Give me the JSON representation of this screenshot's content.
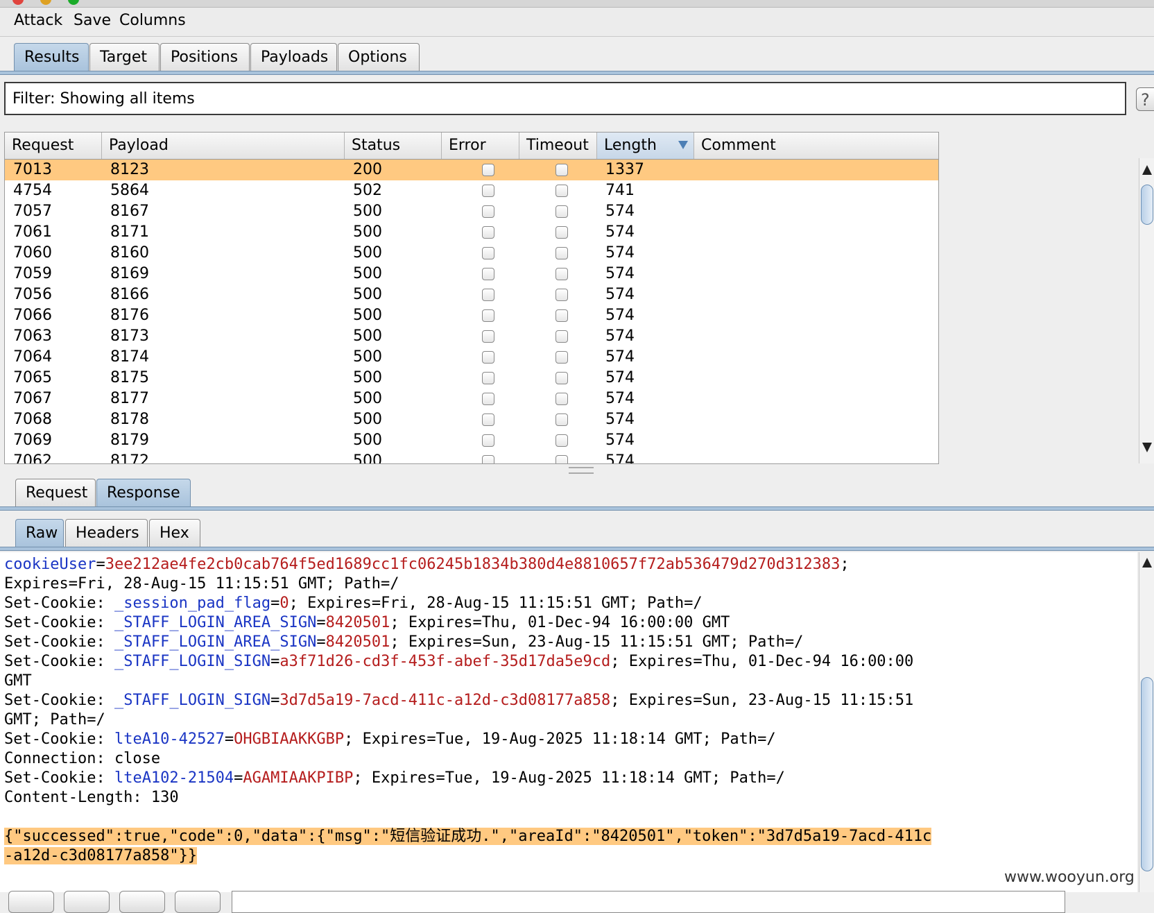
{
  "menu": [
    "Attack",
    "Save",
    "Columns"
  ],
  "main_tabs": [
    {
      "label": "Results",
      "active": true
    },
    {
      "label": "Target",
      "active": false
    },
    {
      "label": "Positions",
      "active": false
    },
    {
      "label": "Payloads",
      "active": false
    },
    {
      "label": "Options",
      "active": false
    }
  ],
  "filter": {
    "text": "Filter:  Showing all items",
    "help": "?"
  },
  "table": {
    "columns": [
      "Request",
      "Payload",
      "Status",
      "Error",
      "Timeout",
      "Length",
      "Comment"
    ],
    "sorted_column": "Length",
    "rows": [
      {
        "request": "7013",
        "payload": "8123",
        "status": "200",
        "length": "1337",
        "selected": true
      },
      {
        "request": "4754",
        "payload": "5864",
        "status": "502",
        "length": "741"
      },
      {
        "request": "7057",
        "payload": "8167",
        "status": "500",
        "length": "574"
      },
      {
        "request": "7061",
        "payload": "8171",
        "status": "500",
        "length": "574"
      },
      {
        "request": "7060",
        "payload": "8160",
        "status": "500",
        "length": "574"
      },
      {
        "request": "7059",
        "payload": "8169",
        "status": "500",
        "length": "574"
      },
      {
        "request": "7056",
        "payload": "8166",
        "status": "500",
        "length": "574"
      },
      {
        "request": "7066",
        "payload": "8176",
        "status": "500",
        "length": "574"
      },
      {
        "request": "7063",
        "payload": "8173",
        "status": "500",
        "length": "574"
      },
      {
        "request": "7064",
        "payload": "8174",
        "status": "500",
        "length": "574"
      },
      {
        "request": "7065",
        "payload": "8175",
        "status": "500",
        "length": "574"
      },
      {
        "request": "7067",
        "payload": "8177",
        "status": "500",
        "length": "574"
      },
      {
        "request": "7068",
        "payload": "8178",
        "status": "500",
        "length": "574"
      },
      {
        "request": "7069",
        "payload": "8179",
        "status": "500",
        "length": "574"
      },
      {
        "request": "7062",
        "payload": "8172",
        "status": "500",
        "length": "574"
      }
    ]
  },
  "req_resp_tabs": [
    {
      "label": "Request",
      "active": false
    },
    {
      "label": "Response",
      "active": true
    }
  ],
  "view_tabs": [
    {
      "label": "Raw",
      "active": true
    },
    {
      "label": "Headers",
      "active": false
    },
    {
      "label": "Hex",
      "active": false
    }
  ],
  "response_lines": [
    [
      {
        "t": "cookieUser",
        "c": "k"
      },
      {
        "t": "="
      },
      {
        "t": "3ee212ae4fe2cb0cab764f5ed1689cc1fc06245b1834b380d4e8810657f72ab536479d270d312383",
        "c": "v"
      },
      {
        "t": ";"
      }
    ],
    [
      {
        "t": "Expires=Fri, 28-Aug-15 11:15:51 GMT; Path=/"
      }
    ],
    [
      {
        "t": "Set-Cookie: "
      },
      {
        "t": "_session_pad_flag",
        "c": "k"
      },
      {
        "t": "="
      },
      {
        "t": "0",
        "c": "v"
      },
      {
        "t": "; Expires=Fri, 28-Aug-15 11:15:51 GMT; Path=/"
      }
    ],
    [
      {
        "t": "Set-Cookie: "
      },
      {
        "t": "_STAFF_LOGIN_AREA_SIGN",
        "c": "k"
      },
      {
        "t": "="
      },
      {
        "t": "8420501",
        "c": "v"
      },
      {
        "t": "; Expires=Thu, 01-Dec-94 16:00:00 GMT"
      }
    ],
    [
      {
        "t": "Set-Cookie: "
      },
      {
        "t": "_STAFF_LOGIN_AREA_SIGN",
        "c": "k"
      },
      {
        "t": "="
      },
      {
        "t": "8420501",
        "c": "v"
      },
      {
        "t": "; Expires=Sun, 23-Aug-15 11:15:51 GMT; Path=/"
      }
    ],
    [
      {
        "t": "Set-Cookie: "
      },
      {
        "t": "_STAFF_LOGIN_SIGN",
        "c": "k"
      },
      {
        "t": "="
      },
      {
        "t": "a3f71d26-cd3f-453f-abef-35d17da5e9cd",
        "c": "v"
      },
      {
        "t": "; Expires=Thu, 01-Dec-94 16:00:00"
      }
    ],
    [
      {
        "t": "GMT"
      }
    ],
    [
      {
        "t": "Set-Cookie: "
      },
      {
        "t": "_STAFF_LOGIN_SIGN",
        "c": "k"
      },
      {
        "t": "="
      },
      {
        "t": "3d7d5a19-7acd-411c-a12d-c3d08177a858",
        "c": "v"
      },
      {
        "t": "; Expires=Sun, 23-Aug-15 11:15:51"
      }
    ],
    [
      {
        "t": "GMT; Path=/"
      }
    ],
    [
      {
        "t": "Set-Cookie: "
      },
      {
        "t": "lteA10-42527",
        "c": "k"
      },
      {
        "t": "="
      },
      {
        "t": "OHGBIAAKKGBP",
        "c": "v"
      },
      {
        "t": "; Expires=Tue, 19-Aug-2025 11:18:14 GMT; Path=/"
      }
    ],
    [
      {
        "t": "Connection: close"
      }
    ],
    [
      {
        "t": "Set-Cookie: "
      },
      {
        "t": "lteA102-21504",
        "c": "k"
      },
      {
        "t": "="
      },
      {
        "t": "AGAMIAAKPIBP",
        "c": "v"
      },
      {
        "t": "; Expires=Tue, 19-Aug-2025 11:18:14 GMT; Path=/"
      }
    ],
    [
      {
        "t": "Content-Length: 130"
      }
    ],
    [
      {
        "t": ""
      }
    ],
    [
      {
        "t": "{\"successed\":true,\"code\":0,\"data\":{\"msg\":\"短信验证成功.\",\"areaId\":\"8420501\",\"token\":\"3d7d5a19-7acd-411c",
        "c": "hl"
      }
    ],
    [
      {
        "t": "-a12d-c3d08177a858\"}}",
        "c": "hl"
      }
    ]
  ],
  "watermark": "www.wooyun.org",
  "colors": {
    "selection": "#ffc981",
    "tab_active": "#a9c3dc",
    "key": "#1a35c4",
    "value": "#b51d1d"
  }
}
